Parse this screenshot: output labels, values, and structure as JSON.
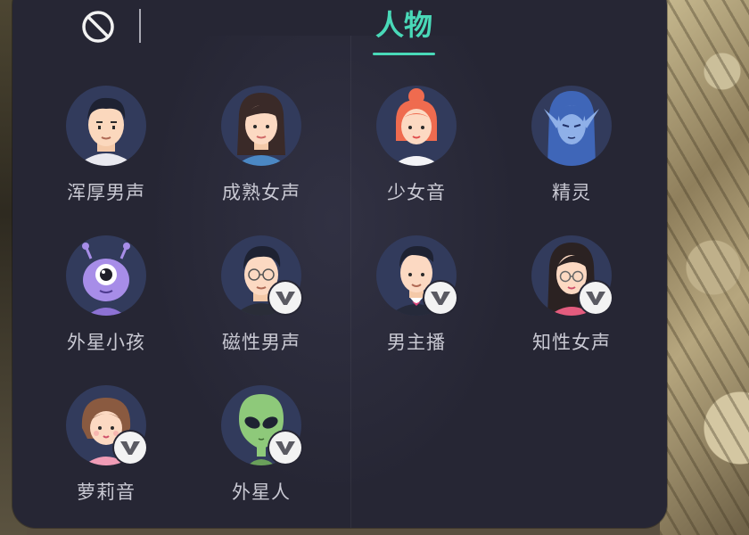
{
  "toolbar": {
    "disable_icon": "prohibit-icon",
    "active_tab": "人物"
  },
  "colors": {
    "accent": "#49d9b8",
    "panel": "#262634",
    "avatar_bg": "#323b5c",
    "label": "#c9c9d3"
  },
  "voices": [
    {
      "label": "浑厚男声",
      "avatar": "deep-male-avatar",
      "vip": false
    },
    {
      "label": "成熟女声",
      "avatar": "mature-female-avatar",
      "vip": false
    },
    {
      "label": "少女音",
      "avatar": "young-girl-avatar",
      "vip": false
    },
    {
      "label": "精灵",
      "avatar": "elf-avatar",
      "vip": false
    },
    {
      "label": "外星小孩",
      "avatar": "alien-kid-avatar",
      "vip": false
    },
    {
      "label": "磁性男声",
      "avatar": "magnetic-male-avatar",
      "vip": true
    },
    {
      "label": "男主播",
      "avatar": "male-host-avatar",
      "vip": true
    },
    {
      "label": "知性女声",
      "avatar": "intellectual-female-avatar",
      "vip": true
    },
    {
      "label": "萝莉音",
      "avatar": "loli-avatar",
      "vip": true
    },
    {
      "label": "外星人",
      "avatar": "alien-avatar",
      "vip": true
    }
  ]
}
